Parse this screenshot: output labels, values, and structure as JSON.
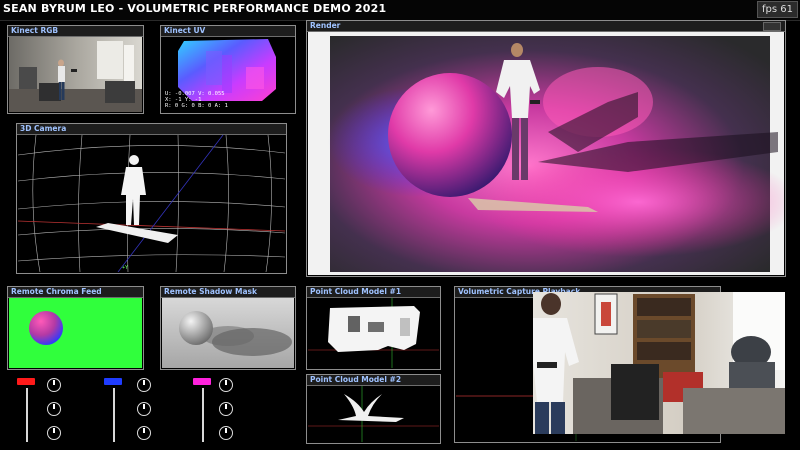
{
  "app": {
    "title": "SEAN BYRUM LEO - VOLUMETRIC PERFORMANCE DEMO 2021",
    "fps": "fps 61"
  },
  "panels": {
    "kinect_rgb": "Kinect RGB",
    "kinect_uv": "Kinect UV",
    "render": "Render",
    "camera_3d": "3D Camera",
    "remote_chroma": "Remote Chroma Feed",
    "remote_shadow": "Remote Shadow Mask",
    "point_cloud_1": "Point Cloud Model #1",
    "point_cloud_2": "Point Cloud Model #2",
    "volumetric_capture": "Volumetric Capture Playback"
  },
  "uv_readout": {
    "line1": "U: -0.007  V: 0.055",
    "line2": "X: -1      Y: -1",
    "line3": "R: 0   G: 0   B: 0   A: 1"
  },
  "controls": {
    "colors": [
      "#ff1a1a",
      "#1f3cff",
      "#ff22dd"
    ]
  }
}
